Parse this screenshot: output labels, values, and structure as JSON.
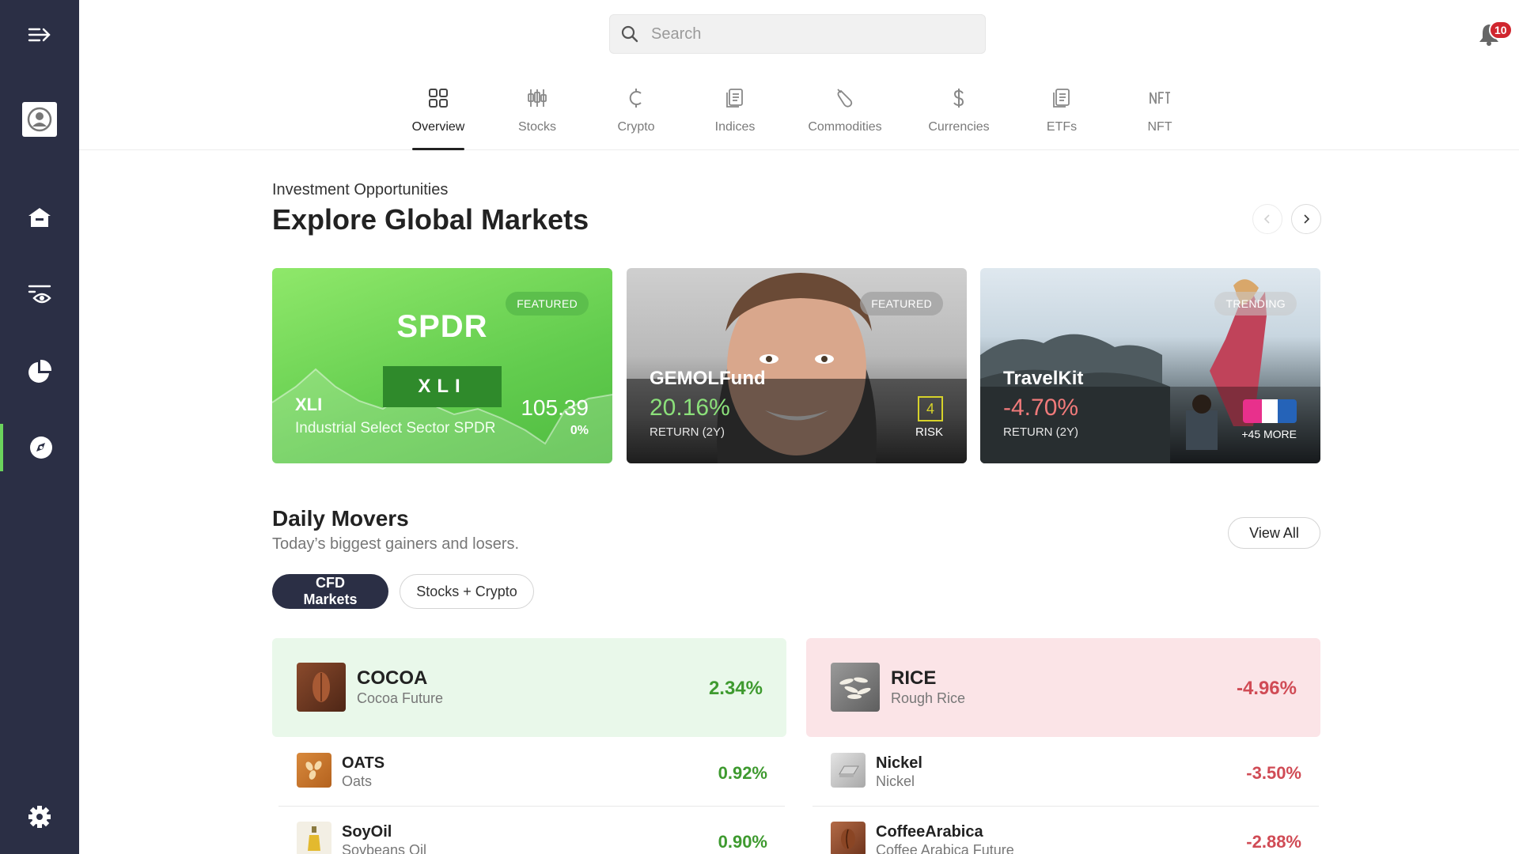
{
  "search": {
    "placeholder": "Search"
  },
  "notifications": {
    "count": "10"
  },
  "tabs": [
    {
      "label": "Overview",
      "icon": "grid-icon"
    },
    {
      "label": "Stocks",
      "icon": "candlestick-icon"
    },
    {
      "label": "Crypto",
      "icon": "crypto-icon"
    },
    {
      "label": "Indices",
      "icon": "document-icon"
    },
    {
      "label": "Commodities",
      "icon": "commodity-icon"
    },
    {
      "label": "Currencies",
      "icon": "dollar-icon"
    },
    {
      "label": "ETFs",
      "icon": "document-icon"
    },
    {
      "label": "NFT",
      "icon": "nft-icon"
    }
  ],
  "opportunities": {
    "eyebrow": "Investment Opportunities",
    "title": "Explore Global Markets"
  },
  "cards": [
    {
      "tag": "FEATURED",
      "brand": "SPDR",
      "ticker_box": "XLI",
      "symbol": "XLI",
      "name": "Industrial Select Sector SPDR",
      "price": "105.39",
      "change": "0%"
    },
    {
      "tag": "FEATURED",
      "name": "GEMOLFund",
      "return": "20.16%",
      "return_label": "RETURN (2Y)",
      "risk": "4",
      "risk_label": "RISK"
    },
    {
      "tag": "TRENDING",
      "name": "TravelKit",
      "return": "-4.70%",
      "return_label": "RETURN (2Y)",
      "more": "+45 MORE"
    }
  ],
  "daily_movers": {
    "title": "Daily Movers",
    "subtitle": "Today’s biggest gainers and losers.",
    "view_all": "View All",
    "filters": [
      "CFD Markets",
      "Stocks + Crypto"
    ],
    "gainers": [
      {
        "symbol": "COCOA",
        "name": "Cocoa Future",
        "change": "2.34%"
      },
      {
        "symbol": "OATS",
        "name": "Oats",
        "change": "0.92%"
      },
      {
        "symbol": "SoyOil",
        "name": "Soybeans Oil",
        "change": "0.90%"
      }
    ],
    "losers": [
      {
        "symbol": "RICE",
        "name": "Rough Rice",
        "change": "-4.96%"
      },
      {
        "symbol": "Nickel",
        "name": "Nickel",
        "change": "-3.50%"
      },
      {
        "symbol": "CoffeeArabica",
        "name": "Coffee Arabica Future",
        "change": "-2.88%"
      }
    ]
  }
}
